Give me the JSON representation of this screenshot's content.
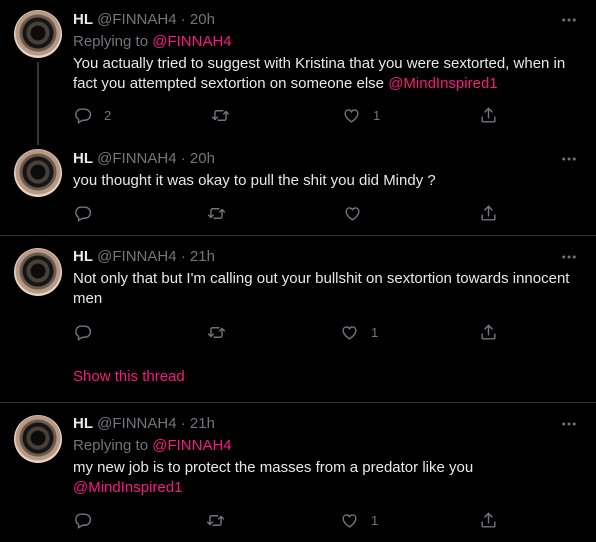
{
  "colors": {
    "background": "#000000",
    "text": "#e7e9ea",
    "muted": "#71767b",
    "accent": "#f91880",
    "divider": "#2f3336"
  },
  "tweets": [
    {
      "name": "HL",
      "handle": "@FINNAH4",
      "time": "· 20h",
      "replying_label": "Replying to",
      "replying_to": "@FINNAH4",
      "text": "You actually tried to suggest with Kristina that you were sextorted, when in fact you attempted sextortion on someone else ",
      "mention": "@MindInspired1",
      "replies": "2",
      "retweets": "",
      "likes": "1"
    },
    {
      "name": "HL",
      "handle": "@FINNAH4",
      "time": "· 20h",
      "text": "you thought it was okay to pull the shit you did Mindy ?",
      "replies": "",
      "retweets": "",
      "likes": ""
    },
    {
      "name": "HL",
      "handle": "@FINNAH4",
      "time": "· 21h",
      "text": "Not only that but I'm calling out your bullshit on sextortion towards innocent men",
      "replies": "",
      "retweets": "",
      "likes": "1",
      "show_thread": "Show this thread"
    },
    {
      "name": "HL",
      "handle": "@FINNAH4",
      "time": "· 21h",
      "replying_label": "Replying to",
      "replying_to": "@FINNAH4",
      "text": "my new job is to protect the masses from a predator like you",
      "mention": "@MindInspired1",
      "replies": "",
      "retweets": "",
      "likes": "1"
    }
  ],
  "icons": {
    "reply": "reply-icon",
    "retweet": "retweet-icon",
    "like": "heart-icon",
    "share": "share-icon",
    "more": "more-icon"
  }
}
